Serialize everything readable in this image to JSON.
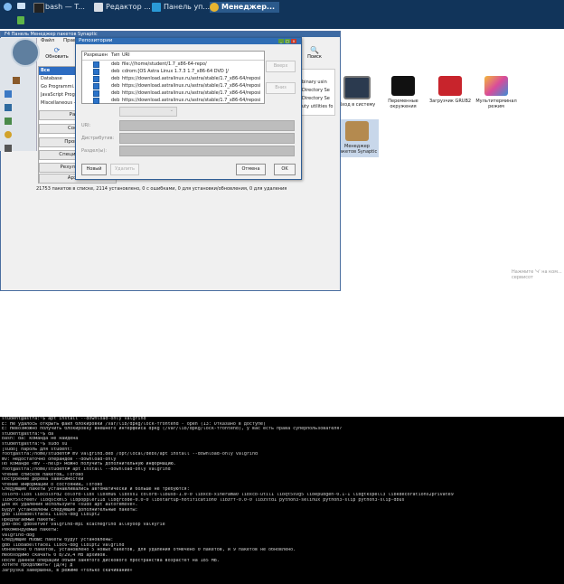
{
  "colors": {
    "taskbar": "#11345a",
    "accent": "#2d6cc1",
    "dialog_title": "#2f6db5",
    "terminal_bg": "#000000"
  },
  "taskbar": {
    "tasks": [
      {
        "label": "bash — T...",
        "icon": "terminal-icon"
      },
      {
        "label": "Редактор ...",
        "icon": "editor-icon"
      },
      {
        "label": "Панель уп...",
        "icon": "control-panel-icon"
      },
      {
        "label": "Менеджер...",
        "icon": "package-manager-icon"
      }
    ]
  },
  "desktop": {
    "icons": [
      {
        "label": "Вход в систему",
        "icon": "login-icon"
      },
      {
        "label": "Переменные окружения",
        "icon": "terminal-icon"
      },
      {
        "label": "Загрузчик GRUB2",
        "icon": "grub-icon"
      },
      {
        "label": "Мультитерминал режим",
        "icon": "multiterminal-icon"
      },
      {
        "label": "Менеджер пакетов Synaptic",
        "icon": "deb-package-icon"
      }
    ],
    "activation_hint": "Нажмите 'ч' на ком... сервисот"
  },
  "synaptic": {
    "title": "F4 Панель  Менеджер пакетов Synaptic",
    "menu": [
      "Файл",
      "Правка"
    ],
    "reload_label": "Обновить",
    "search_label": "Поиск",
    "categories": [
      "Все",
      "Database",
      "Go Programmi...",
      "JavaScript Progr...",
      "Miscellaneous - ..."
    ],
    "side_buttons": [
      "Разд...",
      "Состо...",
      "Происхо...",
      "Специальны...",
      "Результаты...",
      "Архит..."
    ],
    "right_list": [
      "binary usin",
      "Directory Se",
      "Directory Se",
      "uty utilities fo"
    ],
    "status": "21753 пакетов в списке, 2114 установлено, 0 с ошибками, 0 для установки/обновления, 0 для удаления"
  },
  "repo_dialog": {
    "title": "Репозитории",
    "headers": [
      "Разрешен",
      "Тип",
      "URI"
    ],
    "rows": [
      {
        "type": "deb",
        "uri": "file:///home/student/1.7_x86-64-repo/"
      },
      {
        "type": "deb",
        "uri": "cdrom:[OS Astra Linux 1.7.3 1.7_x86-64 DVD ]/"
      },
      {
        "type": "deb",
        "uri": "https://download.astralinux.ru/astra/stable/1.7_x86-64/reposi"
      },
      {
        "type": "deb",
        "uri": "https://download.astralinux.ru/astra/stable/1.7_x86-64/reposi"
      },
      {
        "type": "deb",
        "uri": "https://download.astralinux.ru/astra/stable/1.7_x86-64/reposi"
      },
      {
        "type": "deb",
        "uri": "https://download.astralinux.ru/astra/stable/1.7_x86-64/reposi"
      }
    ],
    "up_label": "Вверх",
    "down_label": "Вниз",
    "uri_label": "URI:",
    "distribution_label": "Дистрибутив:",
    "sections_label": "Раздел(ы):",
    "new_label": "Новый",
    "delete_label": "Удалить",
    "cancel_label": "Отмена",
    "ok_label": "OK"
  },
  "terminal": {
    "lines": [
      "student@astra:~$ apt install --download-only valgrind",
      "E: Не удалось открыть файл блокировки /var/lib/dpkg/lock-frontend - open (13: Отказано в доступе)",
      "E: Невозможно получить блокировку внешнего интерфейса dpkg (/var/lib/dpkg/lock-frontend), у вас есть права суперпользователя?",
      "student@astra:~$ da",
      "bash: da: команда не найдена",
      "student@astra:~$ sudo su",
      "[sudo] пароль для student:",
      "root@astra:/home/student# mv valgrind.deb /opt/local/debs/apt install --download-only valgrind",
      "mv: недостаточно операндов --download-only",
      "По команде «mv --help» можно получить дополнительную информацию.",
      "root@astra:/home/student# apt install --download-only valgrind",
      "Чтение списков пакетов… Готово",
      "Построение дерева зависимостей",
      "Чтение информации о состоянии… Готово",
      "Следующие пакеты устанавливались автоматически и больше не требуются:",
      "  colord-libs libcolord2 colord-libs libxmu6 libxss1 colord-libusb-1.0-0 libxcb-xinerama0 libxcb-util1 libqt5svg5 libepubgen-0.1-1 libgtkspell3 libkdecorations2private9",
      "  libkf5screen7 libqscxml5 libpoppler118 libqrcode-0.0-0 libstartup-notification0 libzrf-0.0-0 libzstd1 python3-selinux python3-slip python3-slip-dbus",
      "Для их удаления используйте «sudo apt autoremove».",
      "Будут установлены следующие дополнительные пакеты:",
      "  gdb libbabeltrace1 libc6-dbg libipt2",
      "Предлагаемые пакеты:",
      "  gdb-doc gdbserver valgrind-mpi kcachegrind alleyoop valkyrie",
      "Рекомендуемые пакеты:",
      "  valgrind-dbg",
      "Следующие НОВЫЕ пакеты будут установлены:",
      "  gdb libbabeltrace1 libc6-dbg libipt2 valgrind",
      "Обновлено 0 пакетов, установлено 5 новых пакетов, для удаления отмечено 0 пакетов, и 9 пакетов не обновлено.",
      "Необходимо скачать 0 B/29,4 MB архивов.",
      "После данной операции объём занятого дискового пространства возрастёт на 185 MB.",
      "Хотите продолжить? [Д/н] д",
      "Загрузка завершена, в режиме «только скачивание»"
    ]
  }
}
